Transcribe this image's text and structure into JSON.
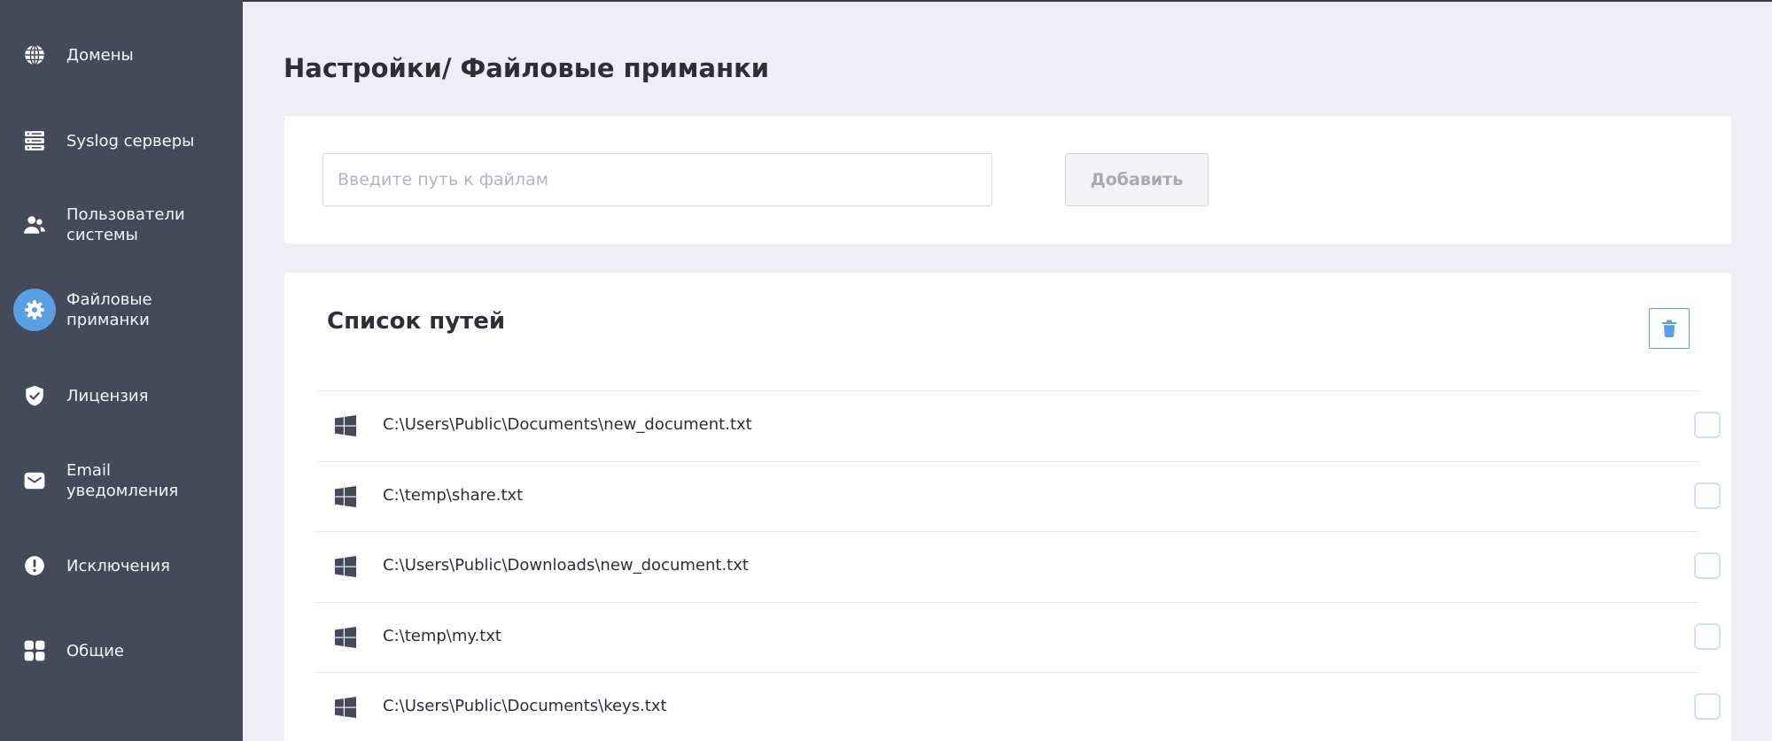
{
  "sidebar": {
    "items": [
      {
        "label": "Домены",
        "icon": "globe-icon",
        "active": false
      },
      {
        "label": "Syslog серверы",
        "icon": "server-icon",
        "active": false
      },
      {
        "label": "Пользователи\nсистемы",
        "icon": "users-icon",
        "active": false
      },
      {
        "label": "Файловые\nприманки",
        "icon": "gear-icon",
        "active": true
      },
      {
        "label": "Лицензия",
        "icon": "shield-check-icon",
        "active": false
      },
      {
        "label": "Email\nуведомления",
        "icon": "envelope-icon",
        "active": false
      },
      {
        "label": "Исключения",
        "icon": "exclamation-icon",
        "active": false
      },
      {
        "label": "Общие",
        "icon": "grid-icon",
        "active": false
      }
    ]
  },
  "page": {
    "title": "Настройки/ Файловые приманки"
  },
  "add_form": {
    "placeholder": "Введите путь к файлам",
    "value": "",
    "add_label": "Добавить"
  },
  "list": {
    "title": "Список путей",
    "rows": [
      {
        "path": "C:\\Users\\Public\\Documents\\new_document.txt",
        "os_icon": "windows-icon",
        "checked": false
      },
      {
        "path": "C:\\temp\\share.txt",
        "os_icon": "windows-icon",
        "checked": false
      },
      {
        "path": "C:\\Users\\Public\\Downloads\\new_document.txt",
        "os_icon": "windows-icon",
        "checked": false
      },
      {
        "path": "C:\\temp\\my.txt",
        "os_icon": "windows-icon",
        "checked": false
      },
      {
        "path": "C:\\Users\\Public\\Documents\\keys.txt",
        "os_icon": "windows-icon",
        "checked": false
      }
    ]
  },
  "colors": {
    "sidebar_bg": "#454a5a",
    "active_accent": "#5b9fe3",
    "page_bg": "#eceff4"
  }
}
